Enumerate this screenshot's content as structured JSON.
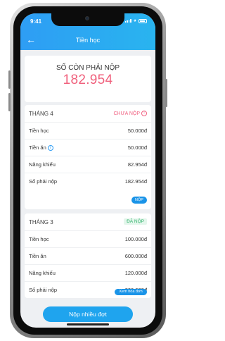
{
  "status_bar": {
    "time": "9:41"
  },
  "header": {
    "title": "Tiền học"
  },
  "summary": {
    "label": "SỐ CÒN PHẢI NỘP",
    "amount": "182.954"
  },
  "months": [
    {
      "month": "THÁNG 4",
      "status": "CHƯA NỘP",
      "rows": [
        {
          "label": "Tiền học",
          "value": "50.000đ"
        },
        {
          "label": "Tiền ăn",
          "value": "50.000đ"
        },
        {
          "label": "Năng khiếu",
          "value": "82.954đ"
        },
        {
          "label": "Số  phải nộp",
          "value": "182.954đ"
        }
      ],
      "action": "NỘP"
    },
    {
      "month": "THÁNG 3",
      "status": "ĐÃ NỘP",
      "rows": [
        {
          "label": "Tiền học",
          "value": "100.000đ"
        },
        {
          "label": "Tiền ăn",
          "value": "600.000đ"
        },
        {
          "label": "Năng khiếu",
          "value": "120.000đ"
        },
        {
          "label": "Số  phải nộp",
          "value": "820.000đ"
        }
      ],
      "action": "Xem hóa đơn"
    }
  ],
  "bottom_button": "Nộp nhiều đợt",
  "colors": {
    "accent": "#2e9df4",
    "amount": "#f0607c",
    "paid": "#2fb36a",
    "unpaid": "#f06080"
  }
}
